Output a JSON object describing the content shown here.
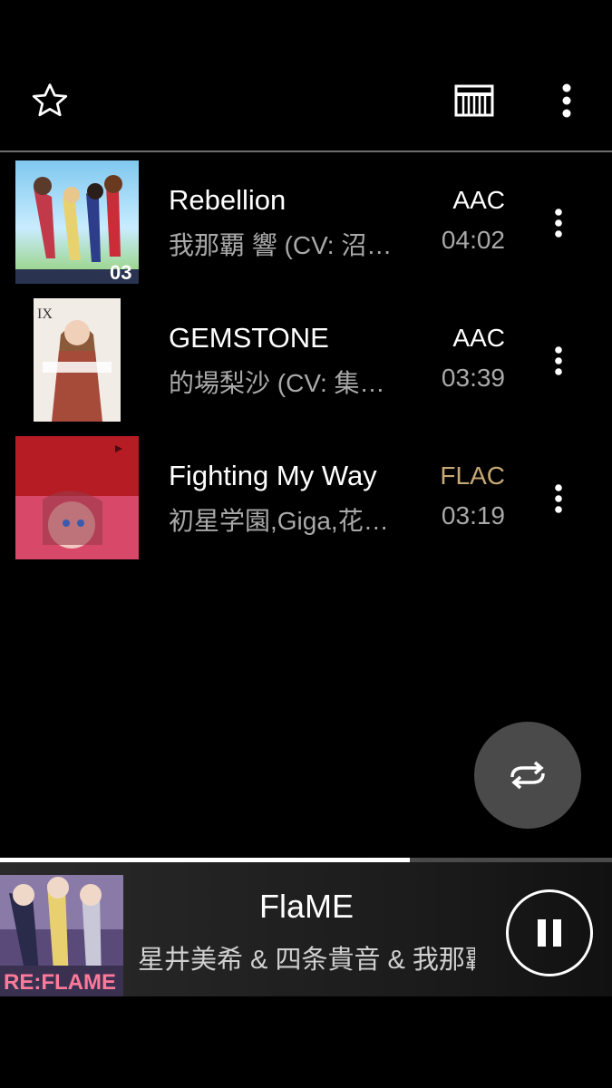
{
  "header": {
    "icons": [
      "star-outline-icon",
      "keyboard-icon",
      "overflow-menu-icon"
    ]
  },
  "tracks": [
    {
      "title": "Rebellion",
      "artist": "我那覇 響 (CV: 沼…",
      "format": "AAC",
      "duration": "04:02",
      "art_badge": "03"
    },
    {
      "title": "GEMSTONE",
      "artist": "的場梨沙 (CV: 集…",
      "format": "AAC",
      "duration": "03:39",
      "art_badge": "IX"
    },
    {
      "title": "Fighting My Way",
      "artist": "初星学園,Giga,花…",
      "format": "FLAC",
      "duration": "03:19",
      "art_badge": ""
    }
  ],
  "colors": {
    "flac": "#c7a876",
    "background": "#000000",
    "secondary_text": "#a9a9a9"
  },
  "now_playing": {
    "title": "FlaME",
    "artist": "星井美希 & 四条貴音 & 我那覇",
    "art_text": "RE:FLAME",
    "progress": 0.67
  },
  "fab": {
    "icon": "repeat-icon"
  },
  "controls": {
    "icon": "pause-icon"
  }
}
